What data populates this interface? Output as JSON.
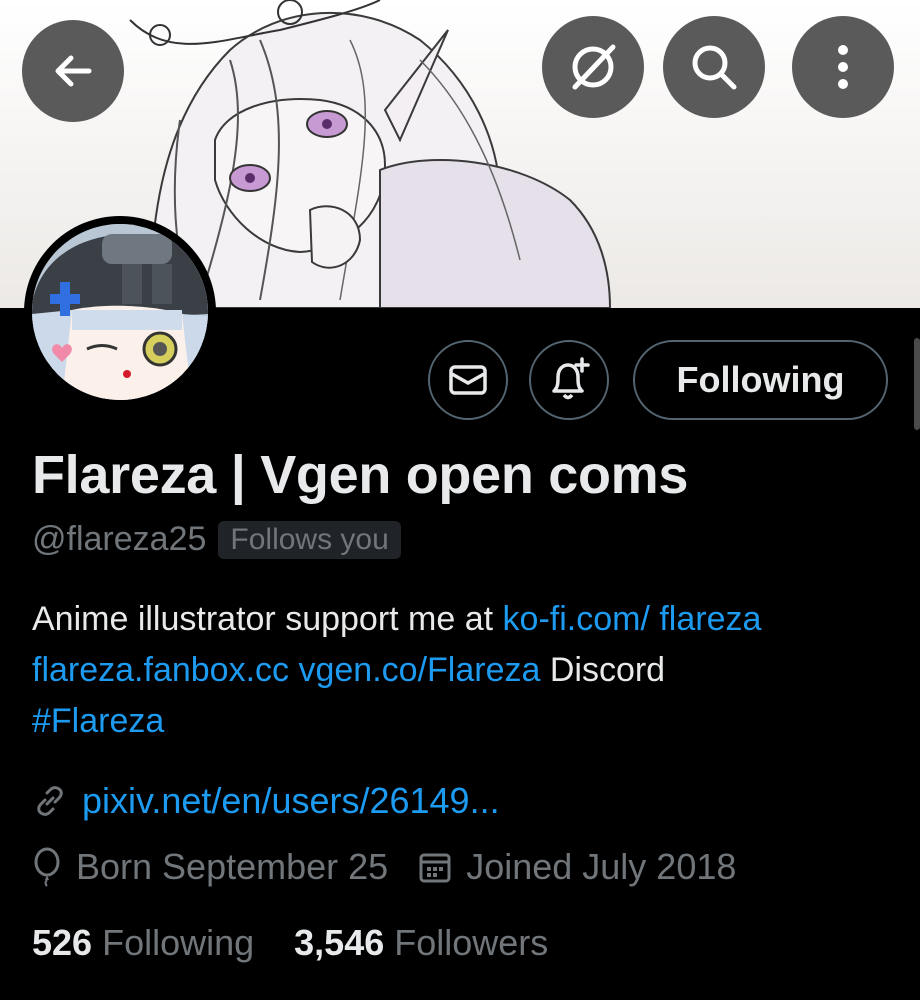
{
  "header": {
    "back_icon": "arrow-left-icon",
    "block_icon": "circle-slash-icon",
    "search_icon": "search-icon",
    "more_icon": "more-vertical-icon"
  },
  "profile": {
    "display_name": "Flareza | Vgen open coms",
    "handle": "@flareza25",
    "follows_you": "Follows you",
    "bio": {
      "text_start": "Anime illustrator  support me at ",
      "link1": "ko-fi.com/ flareza",
      "link2": "flareza.fanbox.cc",
      "link3": "vgen.co/Flareza",
      "text_mid": " Discord ",
      "hashtag": "#Flareza"
    },
    "website": "pixiv.net/en/users/26149...",
    "birthday": "Born September 25",
    "joined": "Joined July 2018",
    "following_count": "526",
    "following_label": "Following",
    "followers_count": "3,546",
    "followers_label": "Followers"
  },
  "actions": {
    "following_button": "Following"
  },
  "colors": {
    "background": "#000000",
    "text_primary": "#e7e9ea",
    "text_secondary": "#71767b",
    "link": "#1d9bf0",
    "border": "#536471"
  }
}
